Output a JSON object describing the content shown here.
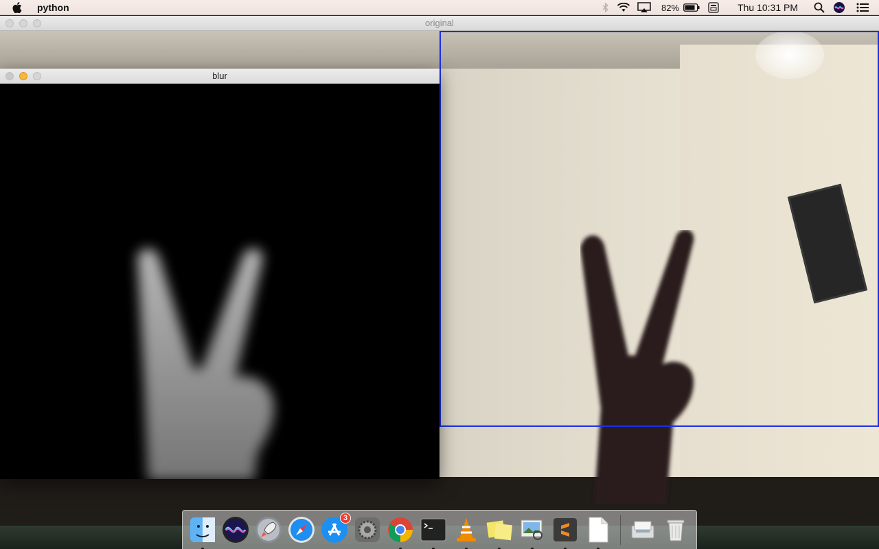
{
  "menubar": {
    "app_name": "python",
    "battery_percent": "82%",
    "clock": "Thu 10:31 PM",
    "icons": [
      "apple-icon",
      "bluetooth-icon",
      "wifi-icon",
      "airplay-icon",
      "battery-icon",
      "keyboard-input-icon",
      "spotlight-icon",
      "siri-icon",
      "notification-center-icon"
    ]
  },
  "windows": {
    "original": {
      "title": "original"
    },
    "blur": {
      "title": "blur"
    }
  },
  "dock": {
    "items": [
      {
        "name": "finder",
        "running": true
      },
      {
        "name": "siri",
        "running": false
      },
      {
        "name": "launchpad",
        "running": false
      },
      {
        "name": "safari",
        "running": false
      },
      {
        "name": "app-store",
        "running": false,
        "badge": "3"
      },
      {
        "name": "system-preferences",
        "running": false
      },
      {
        "name": "chrome",
        "running": true
      },
      {
        "name": "terminal",
        "running": true
      },
      {
        "name": "vlc",
        "running": true
      },
      {
        "name": "stickies",
        "running": true
      },
      {
        "name": "preview",
        "running": true
      },
      {
        "name": "sublime-text",
        "running": true
      },
      {
        "name": "python-document",
        "running": true
      },
      {
        "name": "downloads-stack",
        "running": false
      },
      {
        "name": "trash",
        "running": false
      }
    ],
    "app_store_badge": "3"
  },
  "colors": {
    "roi_border": "#1a2fe6",
    "minimize_light": "#f6b73c"
  }
}
